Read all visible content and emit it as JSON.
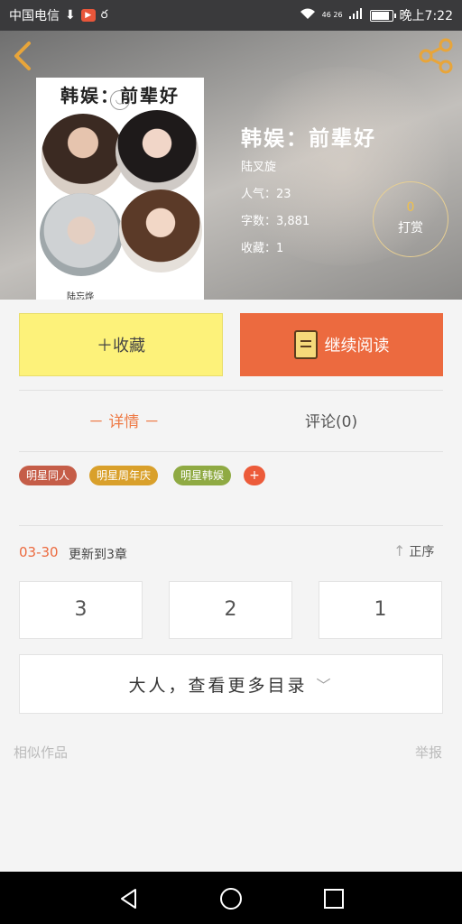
{
  "status_bar": {
    "carrier": "中国电信",
    "network": "46 26",
    "time": "晚上7:22",
    "battery_level": 0.8
  },
  "cover": {
    "title": "韩娱：前辈好",
    "author_sig": "陆忘烨"
  },
  "book": {
    "title": "韩娱：前辈好",
    "author": "陆叉旋",
    "popularity": "人气：23",
    "word_count": "字数：3,881",
    "favorites": "收藏：1"
  },
  "reward": {
    "count": "0",
    "label": "打赏"
  },
  "actions": {
    "collect": "＋收藏",
    "continue_read": "继续阅读"
  },
  "tabs": {
    "detail": "－ 详情 －",
    "comments": "评论(0)"
  },
  "tags": [
    {
      "label": "明星同人",
      "color": "#c55d48"
    },
    {
      "label": "明星周年庆",
      "color": "#d9a02b"
    },
    {
      "label": "明星韩娱",
      "color": "#8faa43"
    }
  ],
  "tag_add": "+",
  "update": {
    "date": "03-30",
    "text": "更新到3章",
    "sort": "正序"
  },
  "chapters": [
    "3",
    "2",
    "1"
  ],
  "more_toc": "大人，查看更多目录",
  "footer": {
    "similar": "相似作品",
    "report": "举报"
  },
  "colors": {
    "accent": "#ec6a3f",
    "collect_bg": "#fdf27a",
    "reward_ring": "#e7cf93"
  }
}
